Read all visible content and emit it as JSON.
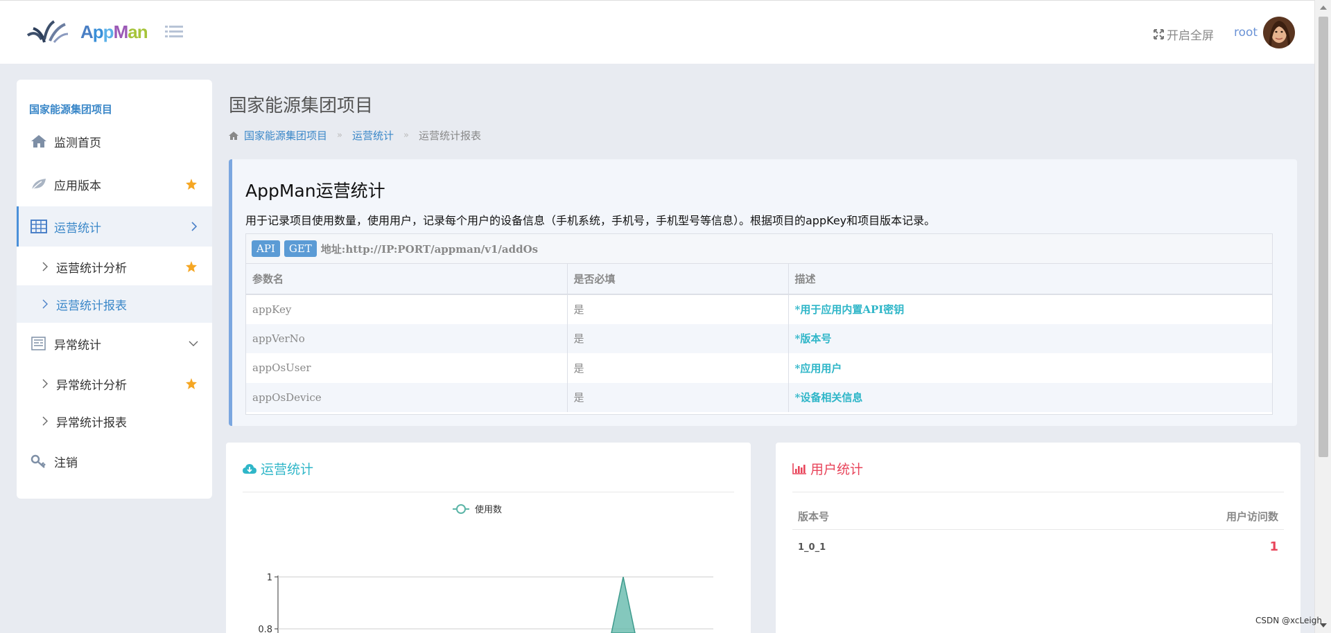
{
  "header": {
    "logo_text": "AppMan",
    "fullscreen_label": "开启全屏",
    "username": "root"
  },
  "sidebar": {
    "project_name": "国家能源集团项目",
    "items": [
      {
        "label": "监测首页",
        "icon": "home-icon"
      },
      {
        "label": "应用版本",
        "icon": "leaf-icon",
        "starred": true
      },
      {
        "label": "运营统计",
        "icon": "table-icon",
        "active": true
      },
      {
        "label": "运营统计分析",
        "sub": true,
        "starred": true
      },
      {
        "label": "运营统计报表",
        "sub": true,
        "active": true
      },
      {
        "label": "异常统计",
        "icon": "report-icon",
        "expanded": true
      },
      {
        "label": "异常统计分析",
        "sub": true,
        "starred": true
      },
      {
        "label": "异常统计报表",
        "sub": true
      },
      {
        "label": "注销",
        "icon": "key-icon"
      }
    ]
  },
  "main": {
    "title": "国家能源集团项目",
    "breadcrumb": [
      "国家能源集团项目",
      "运营统计",
      "运营统计报表"
    ],
    "api_card": {
      "title": "AppMan运营统计",
      "description": "用于记录项目使用数量，使用用户，记录每个用户的设备信息（手机系统，手机号，手机型号等信息）。根据项目的appKey和项目版本记录。",
      "badges": [
        "API",
        "GET"
      ],
      "url_label": "地址:http://IP:PORT/appman/v1/addOs",
      "columns": [
        "参数名",
        "是否必填",
        "描述"
      ],
      "rows": [
        [
          "appKey",
          "是",
          "*用于应用内置API密钥"
        ],
        [
          "appVerNo",
          "是",
          "*版本号"
        ],
        [
          "appOsUser",
          "是",
          "*应用用户"
        ],
        [
          "appOsDevice",
          "是",
          "*设备相关信息"
        ]
      ]
    },
    "ops_card": {
      "title": "运营统计",
      "title_color": "#2fb6c8"
    },
    "users_card": {
      "title": "用户统计",
      "title_color": "#e8455b",
      "columns": [
        "版本号",
        "用户访问数"
      ],
      "rows": [
        [
          "1_0_1",
          "1"
        ]
      ]
    }
  },
  "chart_data": {
    "type": "line",
    "legend": [
      "使用数"
    ],
    "legend_position": "top-center",
    "series": [
      {
        "name": "使用数",
        "color": "#5bb5a7",
        "peak_value": 1
      }
    ],
    "y_ticks_visible": [
      "1",
      "0.8"
    ],
    "ylim_visible": [
      0.8,
      1
    ]
  },
  "watermark": "CSDN @xcLeigh"
}
